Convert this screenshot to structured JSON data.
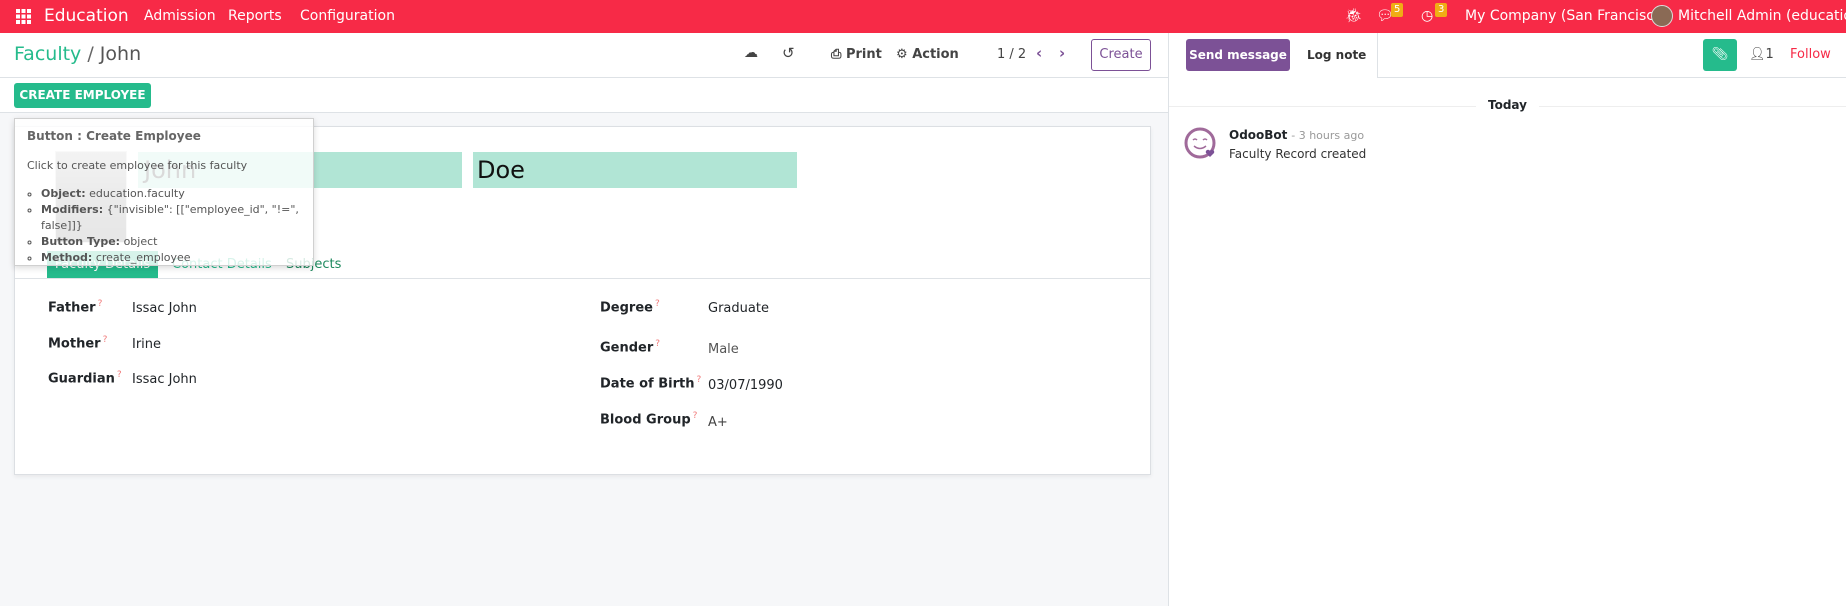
{
  "navbar": {
    "app": "Education",
    "menus": [
      "Admission",
      "Reports",
      "Configuration"
    ],
    "messages_count": "5",
    "activities_count": "3",
    "company": "My Company (San Francisco)",
    "user": "Mitchell Admin (education)",
    "color": "#f72a47"
  },
  "breadcrumb": {
    "parent": "Faculty",
    "sep": "/",
    "current": "John"
  },
  "control": {
    "print": "Print",
    "action": "Action",
    "pager": "1 / 2",
    "create": "Create"
  },
  "form": {
    "create_employee": "CREATE EMPLOYEE",
    "first_name": "John",
    "last_name": "Doe",
    "tabs": [
      "Faculty Details",
      "Contact Details",
      "Subjects"
    ],
    "left_fields": [
      {
        "label": "Father",
        "value": "Issac John"
      },
      {
        "label": "Mother",
        "value": "Irine"
      },
      {
        "label": "Guardian",
        "value": "Issac John"
      }
    ],
    "right_fields": [
      {
        "label": "Degree",
        "value": "Graduate"
      },
      {
        "label": "Gender",
        "value": "Male"
      },
      {
        "label": "Date of Birth",
        "value": "03/07/1990"
      },
      {
        "label": "Blood Group",
        "value": "A+"
      }
    ],
    "help_mark": "?"
  },
  "tooltip": {
    "title": "Button : Create Employee",
    "desc": "Click to create employee for this faculty",
    "items": [
      {
        "k": "Object:",
        "v": "education.faculty"
      },
      {
        "k": "Modifiers:",
        "v": "{\"invisible\": [[\"employee_id\", \"!=\", false]]}"
      },
      {
        "k": "Button Type:",
        "v": "object"
      },
      {
        "k": "Method:",
        "v": "create_employee"
      }
    ]
  },
  "chatter": {
    "send_message": "Send message",
    "log_note": "Log note",
    "followers": "1",
    "follow": "Follow",
    "date_sep": "Today",
    "message": {
      "author": "OdooBot",
      "time": "- 3 hours ago",
      "body": "Faculty Record created"
    }
  },
  "colors": {
    "primary": "#25bb8c",
    "purple": "#7c5196"
  }
}
